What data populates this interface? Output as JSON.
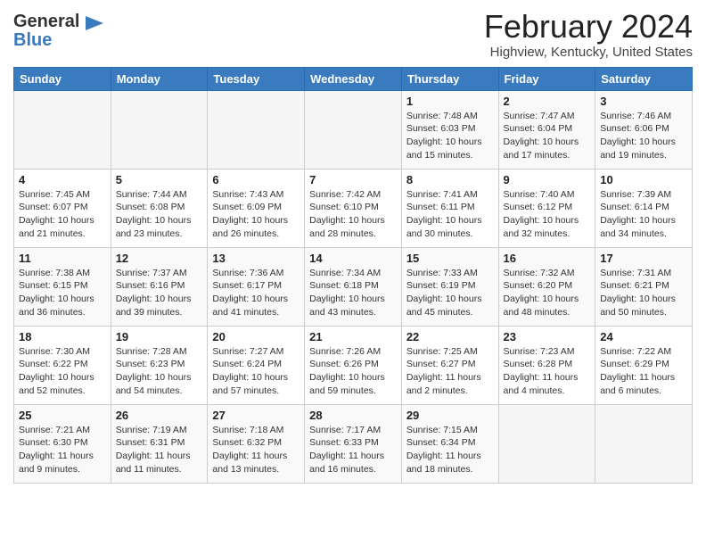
{
  "header": {
    "logo_general": "General",
    "logo_blue": "Blue",
    "title": "February 2024",
    "subtitle": "Highview, Kentucky, United States"
  },
  "days_of_week": [
    "Sunday",
    "Monday",
    "Tuesday",
    "Wednesday",
    "Thursday",
    "Friday",
    "Saturday"
  ],
  "weeks": [
    [
      {
        "day": "",
        "info": ""
      },
      {
        "day": "",
        "info": ""
      },
      {
        "day": "",
        "info": ""
      },
      {
        "day": "",
        "info": ""
      },
      {
        "day": "1",
        "info": "Sunrise: 7:48 AM\nSunset: 6:03 PM\nDaylight: 10 hours and 15 minutes."
      },
      {
        "day": "2",
        "info": "Sunrise: 7:47 AM\nSunset: 6:04 PM\nDaylight: 10 hours and 17 minutes."
      },
      {
        "day": "3",
        "info": "Sunrise: 7:46 AM\nSunset: 6:06 PM\nDaylight: 10 hours and 19 minutes."
      }
    ],
    [
      {
        "day": "4",
        "info": "Sunrise: 7:45 AM\nSunset: 6:07 PM\nDaylight: 10 hours and 21 minutes."
      },
      {
        "day": "5",
        "info": "Sunrise: 7:44 AM\nSunset: 6:08 PM\nDaylight: 10 hours and 23 minutes."
      },
      {
        "day": "6",
        "info": "Sunrise: 7:43 AM\nSunset: 6:09 PM\nDaylight: 10 hours and 26 minutes."
      },
      {
        "day": "7",
        "info": "Sunrise: 7:42 AM\nSunset: 6:10 PM\nDaylight: 10 hours and 28 minutes."
      },
      {
        "day": "8",
        "info": "Sunrise: 7:41 AM\nSunset: 6:11 PM\nDaylight: 10 hours and 30 minutes."
      },
      {
        "day": "9",
        "info": "Sunrise: 7:40 AM\nSunset: 6:12 PM\nDaylight: 10 hours and 32 minutes."
      },
      {
        "day": "10",
        "info": "Sunrise: 7:39 AM\nSunset: 6:14 PM\nDaylight: 10 hours and 34 minutes."
      }
    ],
    [
      {
        "day": "11",
        "info": "Sunrise: 7:38 AM\nSunset: 6:15 PM\nDaylight: 10 hours and 36 minutes."
      },
      {
        "day": "12",
        "info": "Sunrise: 7:37 AM\nSunset: 6:16 PM\nDaylight: 10 hours and 39 minutes."
      },
      {
        "day": "13",
        "info": "Sunrise: 7:36 AM\nSunset: 6:17 PM\nDaylight: 10 hours and 41 minutes."
      },
      {
        "day": "14",
        "info": "Sunrise: 7:34 AM\nSunset: 6:18 PM\nDaylight: 10 hours and 43 minutes."
      },
      {
        "day": "15",
        "info": "Sunrise: 7:33 AM\nSunset: 6:19 PM\nDaylight: 10 hours and 45 minutes."
      },
      {
        "day": "16",
        "info": "Sunrise: 7:32 AM\nSunset: 6:20 PM\nDaylight: 10 hours and 48 minutes."
      },
      {
        "day": "17",
        "info": "Sunrise: 7:31 AM\nSunset: 6:21 PM\nDaylight: 10 hours and 50 minutes."
      }
    ],
    [
      {
        "day": "18",
        "info": "Sunrise: 7:30 AM\nSunset: 6:22 PM\nDaylight: 10 hours and 52 minutes."
      },
      {
        "day": "19",
        "info": "Sunrise: 7:28 AM\nSunset: 6:23 PM\nDaylight: 10 hours and 54 minutes."
      },
      {
        "day": "20",
        "info": "Sunrise: 7:27 AM\nSunset: 6:24 PM\nDaylight: 10 hours and 57 minutes."
      },
      {
        "day": "21",
        "info": "Sunrise: 7:26 AM\nSunset: 6:26 PM\nDaylight: 10 hours and 59 minutes."
      },
      {
        "day": "22",
        "info": "Sunrise: 7:25 AM\nSunset: 6:27 PM\nDaylight: 11 hours and 2 minutes."
      },
      {
        "day": "23",
        "info": "Sunrise: 7:23 AM\nSunset: 6:28 PM\nDaylight: 11 hours and 4 minutes."
      },
      {
        "day": "24",
        "info": "Sunrise: 7:22 AM\nSunset: 6:29 PM\nDaylight: 11 hours and 6 minutes."
      }
    ],
    [
      {
        "day": "25",
        "info": "Sunrise: 7:21 AM\nSunset: 6:30 PM\nDaylight: 11 hours and 9 minutes."
      },
      {
        "day": "26",
        "info": "Sunrise: 7:19 AM\nSunset: 6:31 PM\nDaylight: 11 hours and 11 minutes."
      },
      {
        "day": "27",
        "info": "Sunrise: 7:18 AM\nSunset: 6:32 PM\nDaylight: 11 hours and 13 minutes."
      },
      {
        "day": "28",
        "info": "Sunrise: 7:17 AM\nSunset: 6:33 PM\nDaylight: 11 hours and 16 minutes."
      },
      {
        "day": "29",
        "info": "Sunrise: 7:15 AM\nSunset: 6:34 PM\nDaylight: 11 hours and 18 minutes."
      },
      {
        "day": "",
        "info": ""
      },
      {
        "day": "",
        "info": ""
      }
    ]
  ],
  "colors": {
    "header_bg": "#3a7abf",
    "header_text": "#ffffff",
    "logo_blue": "#3a7abf"
  }
}
